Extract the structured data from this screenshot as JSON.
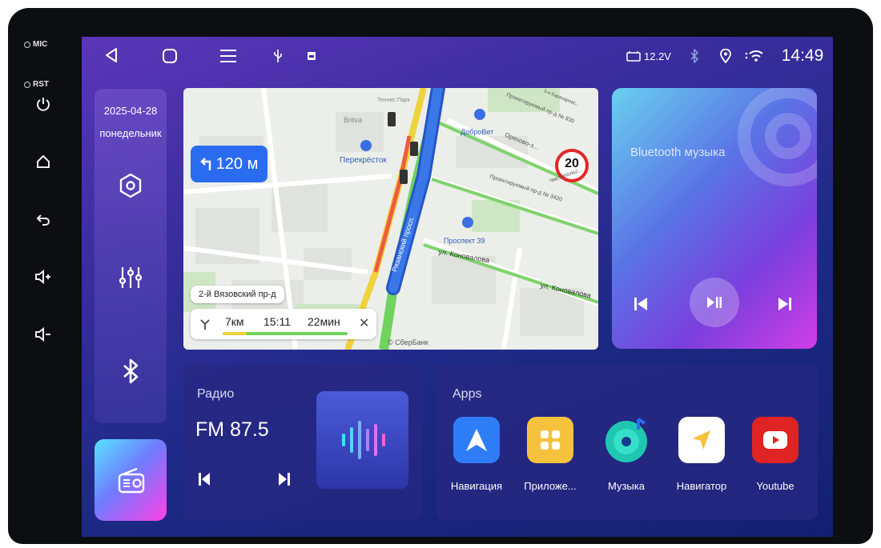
{
  "hardware": {
    "mic_label": "MIC",
    "rst_label": "RST"
  },
  "status": {
    "voltage": "12.2V",
    "time": "14:49"
  },
  "left_panel": {
    "date": "2025-04-28",
    "weekday": "понедельник"
  },
  "map": {
    "turn_distance": "120 м",
    "street_name": "2-й Вязовский пр-д",
    "speed_limit": "20",
    "trip": {
      "distance": "7км",
      "eta": "15:11",
      "duration": "22мин"
    },
    "attribution": "© СберБанк",
    "labels": {
      "perekrestok": "Перекрёсток",
      "dobrovet": "ДоброВет",
      "prospekt39": "Проспект 39",
      "konovalova1": "ул. Коновалова",
      "konovalova2": "ул. Коновалова",
      "ryazansky": "Рязанский просп.",
      "britva": "Britva",
      "tennis": "Теннис Парк",
      "orekhovo": "Орехово-з...",
      "proekt1": "Проектируемый пр-д № 830",
      "proekt2": "Проектируемый пр-д № 3420",
      "karacharovo": "3-я Карачаровс...",
      "chistopol": "Чистопольс..."
    }
  },
  "bluetooth": {
    "title": "Bluetooth музыка"
  },
  "radio": {
    "title": "Радио",
    "frequency": "FM 87.5"
  },
  "apps": {
    "title": "Apps",
    "items": [
      {
        "label": "Навигация",
        "icon": "navigation-arrow-icon",
        "color": "#2f7df6"
      },
      {
        "label": "Приложе...",
        "icon": "apps-grid-icon",
        "color": "#f6c23e"
      },
      {
        "label": "Музыка",
        "icon": "music-disc-icon",
        "color": "#2fd6b8"
      },
      {
        "label": "Навигатор",
        "icon": "navigator-arrow-icon",
        "color": "#ffffff"
      },
      {
        "label": "Youtube",
        "icon": "youtube-play-icon",
        "color": "#e02424"
      }
    ]
  }
}
